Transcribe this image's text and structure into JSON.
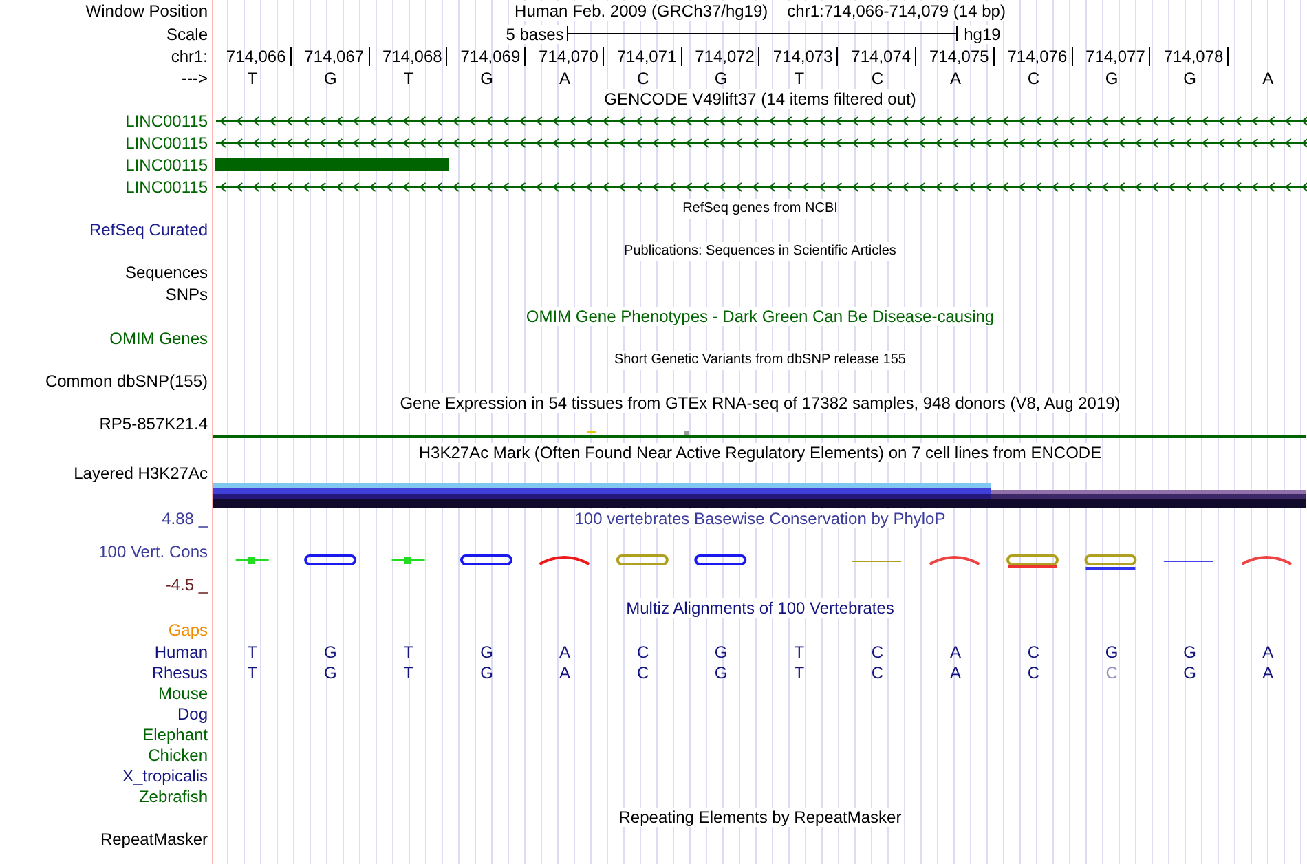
{
  "header": {
    "label": "Window Position",
    "assembly": "Human Feb. 2009 (GRCh37/hg19)",
    "position": "chr1:714,066-714,079 (14 bp)"
  },
  "scale": {
    "label": "Scale",
    "span": "5 bases",
    "db": "hg19"
  },
  "ruler": {
    "label": "chr1:",
    "positions": [
      "714,066",
      "714,067",
      "714,068",
      "714,069",
      "714,070",
      "714,071",
      "714,072",
      "714,073",
      "714,074",
      "714,075",
      "714,076",
      "714,077",
      "714,078"
    ]
  },
  "sequence": {
    "label": "--->",
    "bases": [
      "T",
      "G",
      "T",
      "G",
      "A",
      "C",
      "G",
      "T",
      "C",
      "A",
      "C",
      "G",
      "G",
      "A"
    ]
  },
  "tracks": [
    {
      "kind": "title",
      "text": "GENCODE V49lift37 (14 items filtered out)",
      "color": "#000000"
    },
    {
      "kind": "gene",
      "label": "LINC00115",
      "color": "#006400",
      "exon": false
    },
    {
      "kind": "gene",
      "label": "LINC00115",
      "color": "#006400",
      "exon": false
    },
    {
      "kind": "gene",
      "label": "LINC00115",
      "color": "#006400",
      "exon": true
    },
    {
      "kind": "gene",
      "label": "LINC00115",
      "color": "#006400",
      "exon": false
    },
    {
      "kind": "subtitle",
      "text": "RefSeq genes from NCBI",
      "color": "#000000"
    },
    {
      "kind": "label",
      "label": "RefSeq Curated",
      "color": "#1c1c8c"
    },
    {
      "kind": "subtitle",
      "text": "Publications: Sequences in Scientific Articles",
      "color": "#000000"
    },
    {
      "kind": "label",
      "label": "Sequences",
      "color": "#000000"
    },
    {
      "kind": "label",
      "label": "SNPs",
      "color": "#000000"
    },
    {
      "kind": "title",
      "text": "OMIM Gene Phenotypes - Dark Green Can Be Disease-causing",
      "color": "#006400"
    },
    {
      "kind": "label",
      "label": "OMIM Genes",
      "color": "#006400"
    },
    {
      "kind": "subtitle",
      "text": "Short Genetic Variants from dbSNP release 155",
      "color": "#000000"
    },
    {
      "kind": "label",
      "label": "Common dbSNP(155)",
      "color": "#000000"
    },
    {
      "kind": "title",
      "text": "Gene Expression in 54 tissues from GTEx RNA-seq of 17382 samples, 948 donors (V8, Aug 2019)",
      "color": "#000000"
    },
    {
      "kind": "expression",
      "label": "RP5-857K21.4",
      "color": "#000000"
    },
    {
      "kind": "title",
      "text": "H3K27Ac Mark (Often Found Near Active Regulatory Elements) on 7 cell lines from ENCODE",
      "color": "#000000"
    },
    {
      "kind": "layered",
      "label": "Layered H3K27Ac",
      "color": "#000000"
    },
    {
      "kind": "title",
      "text": "100 vertebrates Basewise Conservation by PhyloP",
      "color": "#3c3c9c",
      "label": "4.88 _"
    },
    {
      "kind": "phylop",
      "label": "100 Vert. Cons",
      "color": "#3c3c9c",
      "bottom": "-4.5 _"
    },
    {
      "kind": "title",
      "text": "Multiz Alignments of 100 Vertebrates",
      "color": "#141480"
    },
    {
      "kind": "label",
      "label": "Gaps",
      "color": "#f08c00"
    },
    {
      "kind": "species",
      "label": "Human",
      "color": "#141480",
      "bases": [
        {
          "base": "T",
          "faded": false
        },
        {
          "base": "G",
          "faded": false
        },
        {
          "base": "T",
          "faded": false
        },
        {
          "base": "G",
          "faded": false
        },
        {
          "base": "A",
          "faded": false
        },
        {
          "base": "C",
          "faded": false
        },
        {
          "base": "G",
          "faded": false
        },
        {
          "base": "T",
          "faded": false
        },
        {
          "base": "C",
          "faded": false
        },
        {
          "base": "A",
          "faded": false
        },
        {
          "base": "C",
          "faded": false
        },
        {
          "base": "G",
          "faded": false
        },
        {
          "base": "G",
          "faded": false
        },
        {
          "base": "A",
          "faded": false
        }
      ]
    },
    {
      "kind": "species",
      "label": "Rhesus",
      "color": "#141480",
      "bases": [
        {
          "base": "T",
          "faded": false
        },
        {
          "base": "G",
          "faded": false
        },
        {
          "base": "T",
          "faded": false
        },
        {
          "base": "G",
          "faded": false
        },
        {
          "base": "A",
          "faded": false
        },
        {
          "base": "C",
          "faded": false
        },
        {
          "base": "G",
          "faded": false
        },
        {
          "base": "T",
          "faded": false
        },
        {
          "base": "C",
          "faded": false
        },
        {
          "base": "A",
          "faded": false
        },
        {
          "base": "C",
          "faded": false
        },
        {
          "base": "C",
          "faded": true
        },
        {
          "base": "G",
          "faded": false
        },
        {
          "base": "A",
          "faded": false
        }
      ]
    },
    {
      "kind": "species",
      "label": "Mouse",
      "color": "#006400"
    },
    {
      "kind": "species",
      "label": "Dog",
      "color": "#141480"
    },
    {
      "kind": "species",
      "label": "Elephant",
      "color": "#006400"
    },
    {
      "kind": "species",
      "label": "Chicken",
      "color": "#006400"
    },
    {
      "kind": "species",
      "label": "X_tropicalis",
      "color": "#141480"
    },
    {
      "kind": "species",
      "label": "Zebrafish",
      "color": "#006400"
    },
    {
      "kind": "title",
      "text": "Repeating Elements by RepeatMasker",
      "color": "#000000"
    },
    {
      "kind": "label",
      "label": "RepeatMasker",
      "color": "#000000"
    }
  ]
}
